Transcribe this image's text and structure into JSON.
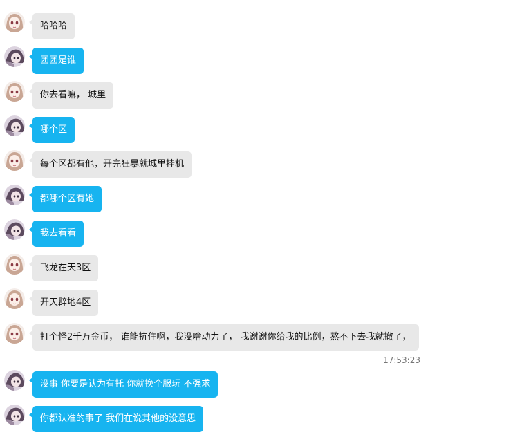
{
  "colors": {
    "my_bubble": "#17b4f0",
    "their_bubble": "#e8e8e8",
    "timestamp_text": "#777777"
  },
  "messages": [
    {
      "sender": "them",
      "text": "哈哈哈"
    },
    {
      "sender": "me",
      "text": "团团是谁"
    },
    {
      "sender": "them",
      "text": "你去看嘛， 城里"
    },
    {
      "sender": "me",
      "text": "哪个区"
    },
    {
      "sender": "them",
      "text": "每个区都有他，开完狂暴就城里挂机"
    },
    {
      "sender": "me",
      "text": "都哪个区有她"
    },
    {
      "sender": "me",
      "text": "我去看看"
    },
    {
      "sender": "them",
      "text": "飞龙在天3区"
    },
    {
      "sender": "them",
      "text": "开天辟地4区"
    },
    {
      "sender": "them",
      "text": "打个怪2千万金币， 谁能抗住啊，我没啥动力了， 我谢谢你给我的比例，熬不下去我就撤了，"
    },
    {
      "sender": "me",
      "text": "没事 你要是认为有托 你就换个服玩 不强求"
    },
    {
      "sender": "me",
      "text": "你都认准的事了 我们在说其他的没意思"
    }
  ],
  "timestamp": "17:53:23"
}
